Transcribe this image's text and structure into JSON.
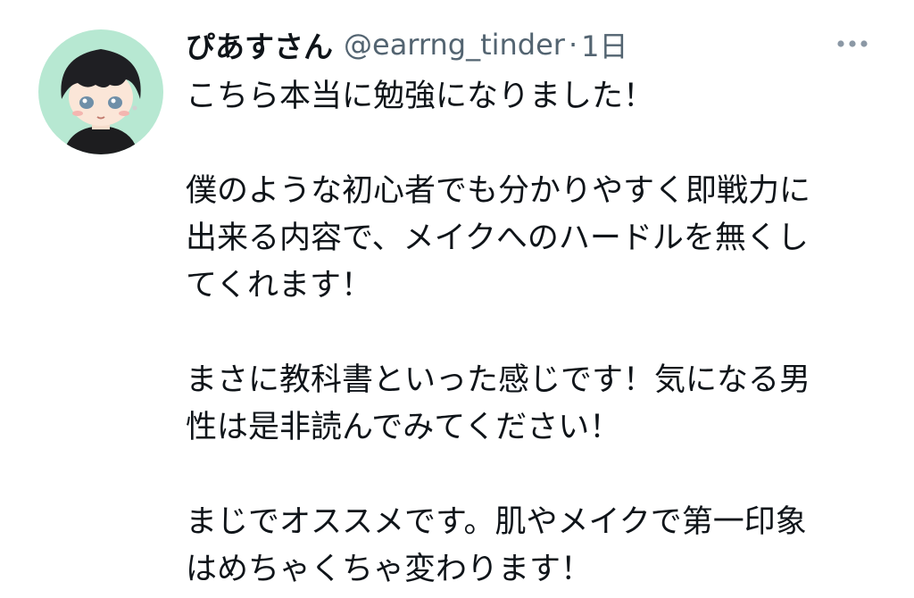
{
  "tweet": {
    "display_name": "ぴあすさん",
    "handle": "@earrng_tinder",
    "separator": "·",
    "time": "1日",
    "more_icon": "more-horizontal-icon",
    "avatar_bg": "#b7e8d2",
    "text_color": "#0f1419",
    "meta_color": "#536471",
    "body": {
      "p1_l1": "こちら本当に勉強になりました！",
      "p2_l1": "僕のような初心者でも分かりやすく即戦力に",
      "p2_l2": "出来る内容で、メイクへのハードルを無くし",
      "p2_l3": "てくれます！",
      "p3_l1": "まさに教科書といった感じです！気になる男",
      "p3_l2": "性は是非読んでみてください！",
      "p4_l1": "まじでオススメです。肌やメイクで第一印象",
      "p4_l2": "はめちゃくちゃ変わります！"
    }
  }
}
